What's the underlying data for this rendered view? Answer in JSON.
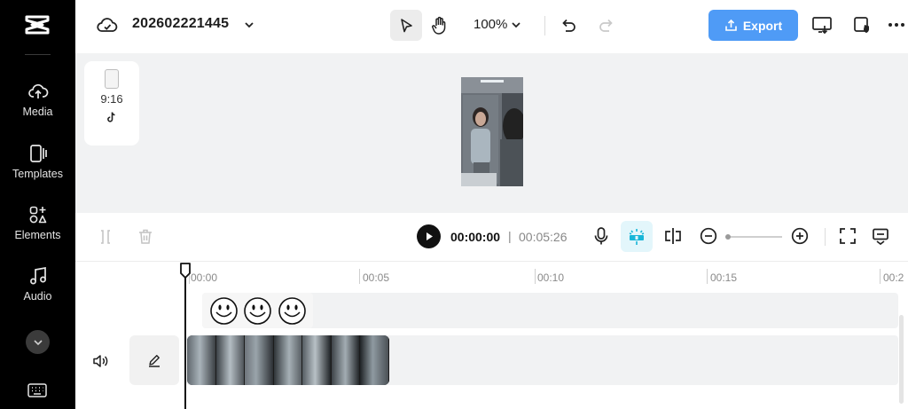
{
  "sidebar": {
    "items": [
      {
        "label": "Media",
        "icon": "cloud-upload-icon"
      },
      {
        "label": "Templates",
        "icon": "templates-icon"
      },
      {
        "label": "Elements",
        "icon": "elements-icon"
      },
      {
        "label": "Audio",
        "icon": "music-note-icon"
      }
    ]
  },
  "header": {
    "project_title": "202602221445",
    "zoom": "100%",
    "export_label": "Export"
  },
  "preview": {
    "aspect_ratio": "9:16"
  },
  "player": {
    "current_time": "00:00:00",
    "separator": "|",
    "total_time": "00:05:26"
  },
  "timeline": {
    "ruler_labels": [
      "00:00",
      "00:05",
      "00:10",
      "00:15",
      "00:2"
    ]
  },
  "colors": {
    "accent": "#4f9bf6",
    "sidebar_bg": "#000000",
    "snap_active_bg": "#e3f6fb",
    "snap_active_fg": "#18b6d8"
  }
}
